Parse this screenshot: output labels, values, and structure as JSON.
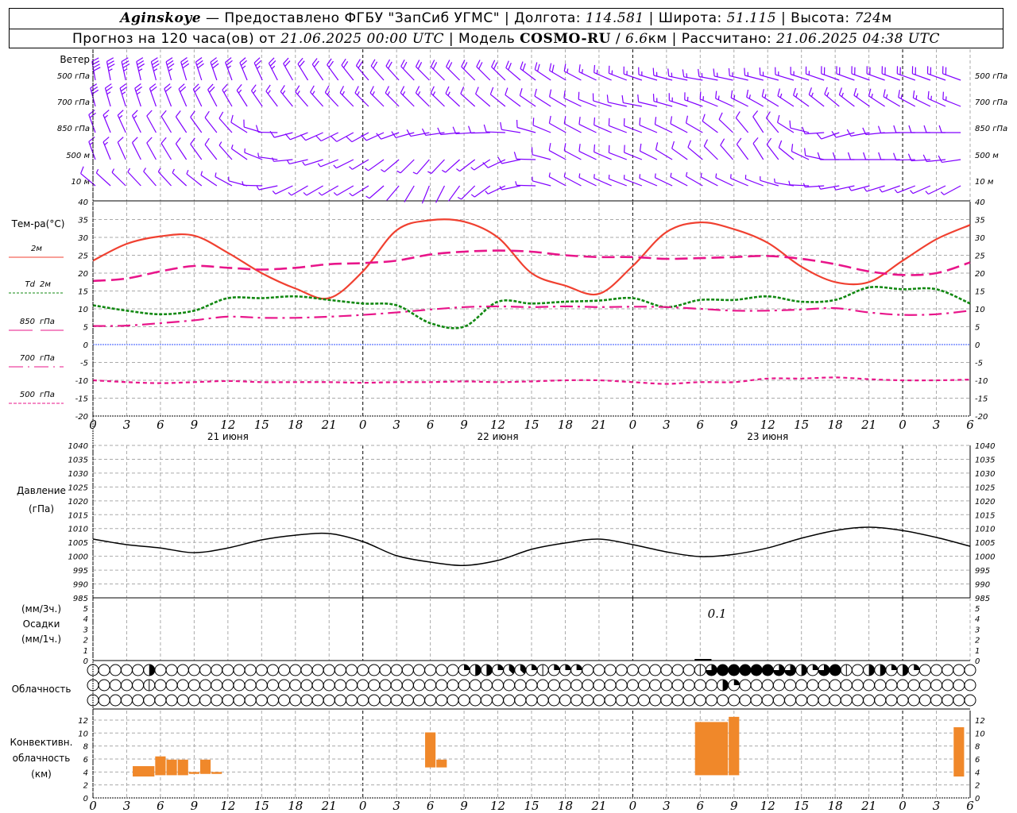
{
  "header": {
    "station": "Aginskoye",
    "provider": " — Предоставлено ФГБУ \"ЗапСиб УГМС\" | Долгота: ",
    "lon": "114.581",
    "lat_label": " | Широта: ",
    "lat": "51.115",
    "alt_label": " | Высота: ",
    "alt": "724",
    "alt_unit": "м",
    "forecast_label": "Прогноз на 120 часа(ов) от ",
    "forecast_start": "21.06.2025 00:00 UTC",
    "model_label": "  | Модель ",
    "model": "COSMO-RU",
    "res_sep": " / ",
    "resolution": "6.6",
    "computed_label": "км | Рассчитано: ",
    "computed": "21.06.2025 04:38 UTC"
  },
  "wind_panel": {
    "title": "Ветер",
    "levels": [
      "500 гПа",
      "700 гПа",
      "850 гПа",
      "500 м",
      "10 м"
    ],
    "color": "#8000ff"
  },
  "temp_panel": {
    "title": "Тем-ра(°C)",
    "legend": [
      {
        "label": "2м",
        "color": "#f04030"
      },
      {
        "label_it": "Td",
        "label": "2м",
        "color": "#118811"
      },
      {
        "label_it": "850",
        "label": "гПа",
        "color": "#e8158a"
      },
      {
        "label_it": "700",
        "label": "гПа",
        "color": "#e8158a"
      },
      {
        "label_it": "500",
        "label": "гПа",
        "color": "#e8158a"
      }
    ]
  },
  "pressure_panel": {
    "title": "Давление",
    "unit": "(гПа)"
  },
  "precip_panel": {
    "unit3": "(мм/3ч.)",
    "title": "Осадки",
    "unit1": "(мм/1ч.)",
    "annotation": "0.1"
  },
  "cloud_panel": {
    "title": "Облачность"
  },
  "conv_panel": {
    "title1": "Конвективн.",
    "title2": "облачность",
    "unit": "(км)",
    "color": "#f0882a"
  },
  "chart_data": [
    {
      "type": "barbs",
      "title": "Ветер",
      "x_unit": "hours",
      "x": [
        0,
        6,
        12,
        18,
        24,
        30,
        36,
        42,
        48,
        54,
        60,
        66,
        72,
        78
      ],
      "series": [
        {
          "name": "500 гПа",
          "dir": [
            350,
            345,
            340,
            330,
            320,
            315,
            315,
            300,
            290,
            280,
            285,
            290,
            290,
            290
          ],
          "speed": [
            20,
            18,
            15,
            12,
            10,
            12,
            12,
            10,
            8,
            8,
            8,
            10,
            10,
            10
          ]
        },
        {
          "name": "700 гПа",
          "dir": [
            345,
            340,
            330,
            320,
            315,
            315,
            310,
            300,
            280,
            290,
            300,
            310,
            300,
            290
          ],
          "speed": [
            15,
            12,
            10,
            8,
            8,
            8,
            7,
            7,
            7,
            8,
            8,
            8,
            8,
            8
          ]
        },
        {
          "name": "850 гПа",
          "dir": [
            340,
            330,
            320,
            250,
            240,
            260,
            270,
            300,
            290,
            300,
            330,
            250,
            270,
            270
          ],
          "speed": [
            10,
            7,
            5,
            5,
            5,
            5,
            6,
            7,
            6,
            6,
            6,
            5,
            6,
            6
          ]
        },
        {
          "name": "500 м",
          "dir": [
            340,
            330,
            320,
            260,
            240,
            220,
            240,
            300,
            290,
            310,
            330,
            270,
            270,
            260
          ],
          "speed": [
            8,
            6,
            5,
            4,
            4,
            3,
            5,
            6,
            5,
            6,
            6,
            5,
            6,
            6
          ]
        },
        {
          "name": "10 м",
          "dir": [
            310,
            320,
            300,
            240,
            240,
            200,
            240,
            300,
            290,
            300,
            290,
            260,
            250,
            240
          ],
          "speed": [
            5,
            4,
            3,
            3,
            3,
            2,
            3,
            4,
            4,
            4,
            4,
            4,
            3,
            4
          ]
        }
      ]
    },
    {
      "type": "line",
      "ylabel": "Тем-ра(°C)",
      "ylim": [
        -20,
        40
      ],
      "yticks": [
        "40",
        "35",
        "30",
        "25",
        "20",
        "15",
        "10",
        "5",
        "0",
        "-5",
        "-10",
        "-15",
        "-20"
      ],
      "x": [
        0,
        3,
        6,
        9,
        12,
        15,
        18,
        21,
        24,
        27,
        30,
        33,
        36,
        39,
        42,
        45,
        48,
        51,
        54,
        57,
        60,
        63,
        66,
        69,
        72,
        75,
        78
      ],
      "series": [
        {
          "name": "2м",
          "values": [
            23.5,
            28.2,
            30.3,
            30.5,
            25.7,
            20,
            15.7,
            13,
            20.5,
            32,
            34.8,
            34.4,
            30,
            20,
            16.5,
            14.2,
            22,
            31.5,
            34.2,
            32.3,
            28.5,
            21.8,
            17.5,
            17.5,
            23.5,
            29.5,
            33.5
          ]
        },
        {
          "name": "Td 2м",
          "values": [
            11,
            9.5,
            8.5,
            9.5,
            13,
            13,
            13.5,
            12.5,
            11.5,
            11,
            6,
            5,
            12,
            11.5,
            12,
            12.3,
            13,
            10.5,
            12.5,
            12.5,
            13.5,
            12,
            12.5,
            16,
            15.5,
            15.5,
            11.5
          ]
        },
        {
          "name": "850 гПа",
          "values": [
            17.8,
            18.5,
            20.5,
            22,
            21.5,
            21,
            21.5,
            22.5,
            22.8,
            23.5,
            25.2,
            26,
            26.3,
            26,
            25,
            24.5,
            24.5,
            24,
            24.2,
            24.5,
            24.8,
            24,
            22.5,
            20.5,
            19.5,
            20,
            23
          ]
        },
        {
          "name": "700 гПа",
          "values": [
            5.2,
            5.3,
            6,
            6.8,
            7.8,
            7.5,
            7.5,
            7.8,
            8.3,
            9,
            9.8,
            10.5,
            10.7,
            10.5,
            10.7,
            10.5,
            10.6,
            10.5,
            10,
            9.5,
            9.5,
            9.8,
            10.2,
            9,
            8.3,
            8.5,
            9.5
          ]
        },
        {
          "name": "500 гПа",
          "values": [
            -10,
            -10.5,
            -10.8,
            -10.5,
            -10.2,
            -10.5,
            -10.5,
            -10.5,
            -10.7,
            -10.5,
            -10.5,
            -10.3,
            -10.5,
            -10.3,
            -10,
            -10,
            -10.5,
            -11,
            -10.5,
            -10.5,
            -9.5,
            -9.5,
            -9.2,
            -9.7,
            -10,
            -10,
            -9.8
          ]
        }
      ]
    },
    {
      "type": "line",
      "ylabel": "Давление (гПа)",
      "ylim": [
        985,
        1040
      ],
      "yticks": [
        "1040",
        "1035",
        "1030",
        "1025",
        "1020",
        "1015",
        "1010",
        "1005",
        "1000",
        "995",
        "990",
        "985"
      ],
      "x": [
        0,
        3,
        6,
        9,
        12,
        15,
        18,
        21,
        24,
        27,
        30,
        33,
        36,
        39,
        42,
        45,
        48,
        51,
        54,
        57,
        60,
        63,
        66,
        69,
        72,
        75,
        78
      ],
      "values": [
        1006.2,
        1004.2,
        1003,
        1001.3,
        1003,
        1005.9,
        1007.6,
        1008.2,
        1005.3,
        1000.2,
        997.9,
        996.7,
        998.5,
        1002.5,
        1004.8,
        1006.2,
        1004.2,
        1001.6,
        999.9,
        1000.7,
        1003,
        1006.5,
        1009.3,
        1010.5,
        1009.3,
        1006.8,
        1003.6
      ]
    },
    {
      "type": "bar",
      "ylabel": "Осадки",
      "ylim": [
        0,
        5
      ],
      "yticks": [
        "5",
        "4",
        "3",
        "2",
        "1",
        "0"
      ],
      "values": []
    },
    {
      "type": "table",
      "title": "Облачность",
      "x_unit": "hours",
      "cover_fraction_rows": [
        {
          "row": 1,
          "nonzero": {
            "5": 0.5,
            "33": 0.25,
            "34": 0.5,
            "35": 0.5,
            "36": 0.25,
            "37": 0.375,
            "38": 0.375,
            "39": 0.25,
            "40": 0.125,
            "41": 0.25,
            "42": 0.25,
            "43": 0.25,
            "54": 0.125,
            "55": 0.75,
            "56": 1,
            "57": 1,
            "58": 1,
            "59": 1,
            "60": 1,
            "61": 0.75,
            "62": 0.75,
            "63": 0.5,
            "64": 0.25,
            "65": 0.75,
            "66": 1,
            "67": 0.125,
            "69": 0.5,
            "70": 0.5,
            "71": 0.25,
            "72": 0.5,
            "73": 0.25
          }
        },
        {
          "row": 2,
          "nonzero": {
            "5": 0.125,
            "56": 0.5,
            "57": 0.25
          }
        },
        {
          "row": 3,
          "nonzero": {}
        }
      ]
    },
    {
      "type": "bar",
      "ylabel": "Конвективн. облачность (км)",
      "ylim": [
        0,
        13
      ],
      "yticks": [
        "12",
        "10",
        "8",
        "6",
        "4",
        "2",
        "0"
      ],
      "bars": [
        {
          "from": 3.5,
          "to": 5.5,
          "base": 3.3,
          "top": 4.9
        },
        {
          "from": 5.5,
          "to": 6.5,
          "base": 3.5,
          "top": 6.4
        },
        {
          "from": 6.5,
          "to": 7.5,
          "base": 3.5,
          "top": 5.9
        },
        {
          "from": 7.5,
          "to": 8.5,
          "base": 3.5,
          "top": 5.9
        },
        {
          "from": 8.5,
          "to": 9.5,
          "base": 3.7,
          "top": 4.0
        },
        {
          "from": 9.5,
          "to": 10.5,
          "base": 3.7,
          "top": 5.9
        },
        {
          "from": 10.5,
          "to": 11.5,
          "base": 3.7,
          "top": 4.0
        },
        {
          "from": 29.5,
          "to": 30.5,
          "base": 4.7,
          "top": 10.1
        },
        {
          "from": 30.5,
          "to": 31.5,
          "base": 4.7,
          "top": 5.9
        },
        {
          "from": 53.5,
          "to": 56.5,
          "base": 3.5,
          "top": 11.7
        },
        {
          "from": 56.5,
          "to": 57.5,
          "base": 3.5,
          "top": 12.5
        },
        {
          "from": 76.5,
          "to": 77.5,
          "base": 3.3,
          "top": 10.9
        }
      ]
    }
  ],
  "x_axis": {
    "hour_labels": [
      "0",
      "3",
      "6",
      "9",
      "12",
      "15",
      "18",
      "21",
      "0",
      "3",
      "6",
      "9",
      "12",
      "15",
      "18",
      "21",
      "0",
      "3",
      "6",
      "9",
      "12",
      "15",
      "18",
      "21",
      "0",
      "3",
      "6"
    ],
    "day_labels": [
      "21 июня",
      "22 июня",
      "23 июня"
    ]
  },
  "colors": {
    "t2m": "#f04030",
    "td": "#118811",
    "upper": "#e8158a",
    "zero": "#3050ff",
    "grid": "#aaaaaa",
    "wind": "#8000ff",
    "conv": "#f0882a"
  }
}
